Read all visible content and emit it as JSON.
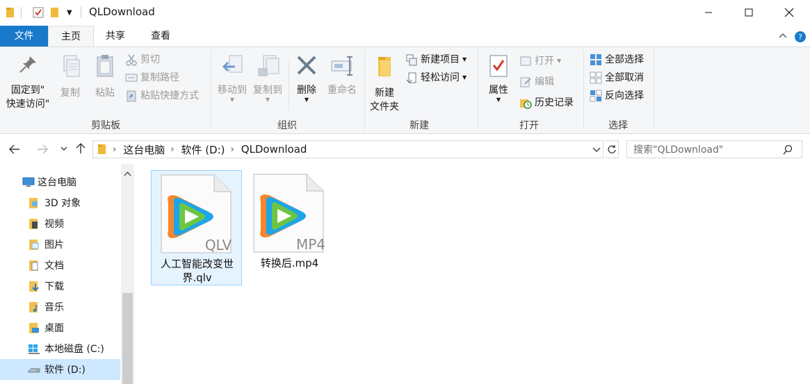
{
  "window": {
    "title": "QLDownload",
    "minimize": "—",
    "maximize": "☐",
    "close": "✕"
  },
  "tabs": {
    "file": "文件",
    "home": "主页",
    "share": "共享",
    "view": "查看"
  },
  "ribbon": {
    "clipboard": {
      "pin_line1": "固定到\"",
      "pin_line2": "快速访问\"",
      "copy": "复制",
      "paste": "粘贴",
      "cut": "剪切",
      "copy_path": "复制路径",
      "paste_shortcut": "粘贴快捷方式",
      "label": "剪贴板"
    },
    "organize": {
      "move_to": "移动到",
      "copy_to": "复制到",
      "delete": "删除",
      "rename": "重命名",
      "label": "组织"
    },
    "new": {
      "new_folder_line1": "新建",
      "new_folder_line2": "文件夹",
      "new_item": "新建项目",
      "easy_access": "轻松访问",
      "label": "新建"
    },
    "open": {
      "properties": "属性",
      "open": "打开",
      "edit": "编辑",
      "history": "历史记录",
      "label": "打开"
    },
    "select": {
      "select_all": "全部选择",
      "select_none": "全部取消",
      "invert": "反向选择",
      "label": "选择"
    }
  },
  "address": {
    "crumbs": [
      "这台电脑",
      "软件 (D:)",
      "QLDownload"
    ],
    "search_placeholder": "搜索\"QLDownload\""
  },
  "nav": {
    "items": [
      {
        "label": "这台电脑"
      },
      {
        "label": "3D 对象"
      },
      {
        "label": "视频"
      },
      {
        "label": "图片"
      },
      {
        "label": "文档"
      },
      {
        "label": "下载"
      },
      {
        "label": "音乐"
      },
      {
        "label": "桌面"
      },
      {
        "label": "本地磁盘 (C:)"
      },
      {
        "label": "软件 (D:)"
      }
    ]
  },
  "files": [
    {
      "name": "人工智能改变世界.qlv",
      "ext": "QLV"
    },
    {
      "name": "转换后.mp4",
      "ext": "MP4"
    }
  ],
  "colors": {
    "accent": "#1979ca",
    "selected": "#cde8ff",
    "folder": "#f7c84b"
  }
}
